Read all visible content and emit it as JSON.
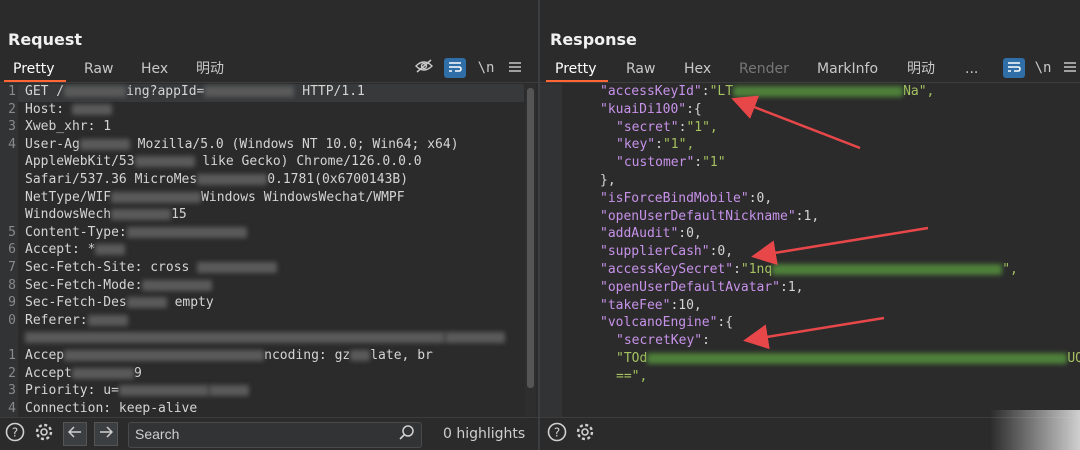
{
  "request": {
    "title": "Request",
    "tabs": [
      "Pretty",
      "Raw",
      "Hex",
      "明动"
    ],
    "active_tab": "Pretty",
    "toolbar_icons": [
      "eye-slash-icon",
      "wrap-icon",
      "newline-icon",
      "menu-icon"
    ],
    "newline_label": "\\n",
    "lines": [
      {
        "n": "1",
        "parts": [
          "GET /",
          "",
          "ing?appId=",
          "",
          " HTTP/1.1"
        ]
      },
      {
        "n": "2",
        "parts": [
          "Host: ",
          ""
        ]
      },
      {
        "n": "3",
        "parts": [
          "Xweb_xhr: 1"
        ]
      },
      {
        "n": "4",
        "parts": [
          "User-Ag",
          "",
          " Mozilla/5.0 (Windows NT 10.0; Win64; x64)"
        ]
      },
      {
        "n": "",
        "parts": [
          "AppleWebKit/53",
          "",
          " like Gecko) Chrome/126.0.0.0"
        ]
      },
      {
        "n": "",
        "parts": [
          "Safari/537.36 MicroMes",
          "",
          "0.1781(0x6700143B)"
        ]
      },
      {
        "n": "",
        "parts": [
          "NetType/WIF",
          "",
          "Windows WindowsWechat/WMPF"
        ]
      },
      {
        "n": "",
        "parts": [
          "WindowsWech",
          "",
          "15"
        ]
      },
      {
        "n": "5",
        "parts": [
          "Content-Type:",
          ""
        ]
      },
      {
        "n": "6",
        "parts": [
          "Accept: *",
          ""
        ]
      },
      {
        "n": "7",
        "parts": [
          "Sec-Fetch-Site: cross ",
          ""
        ]
      },
      {
        "n": "8",
        "parts": [
          "Sec-Fetch-Mode:",
          ""
        ]
      },
      {
        "n": "9",
        "parts": [
          "Sec-Fetch-Des",
          "",
          " empty"
        ]
      },
      {
        "n": "0",
        "parts": [
          "Referer:",
          ""
        ]
      },
      {
        "n": "",
        "parts": [
          "",
          ""
        ]
      },
      {
        "n": "1",
        "parts": [
          "Accep",
          "",
          "ncoding: gz",
          "",
          "late, br"
        ]
      },
      {
        "n": "2",
        "parts": [
          "Accept",
          "",
          "9"
        ]
      },
      {
        "n": "3",
        "parts": [
          "Priority: u=",
          "",
          ""
        ]
      },
      {
        "n": "4",
        "parts": [
          "Connection: keep-alive"
        ]
      }
    ]
  },
  "response": {
    "title": "Response",
    "tabs": [
      "Pretty",
      "Raw",
      "Hex",
      "Render",
      "MarkInfo",
      "明动",
      "..."
    ],
    "active_tab": "Pretty",
    "disabled_tab": "Render",
    "toolbar_icons": [
      "wrap-icon",
      "newline-icon",
      "menu-icon"
    ],
    "newline_label": "\\n",
    "lines": [
      {
        "indent": 1,
        "key": "\"accessKeyId\"",
        "sep": ":",
        "val": "\"LT",
        "blur": "green",
        "tail": "Na\","
      },
      {
        "indent": 1,
        "key": "\"kuaiDi100\"",
        "sep": ":{",
        "val": "",
        "blur": "",
        "tail": ""
      },
      {
        "indent": 2,
        "key": "\"secret\"",
        "sep": ":",
        "val": "\"1\",",
        "blur": "",
        "tail": ""
      },
      {
        "indent": 2,
        "key": "\"key\"",
        "sep": ":",
        "val": "\"1\",",
        "blur": "",
        "tail": ""
      },
      {
        "indent": 2,
        "key": "\"customer\"",
        "sep": ":",
        "val": "\"1\"",
        "blur": "",
        "tail": ""
      },
      {
        "indent": 1,
        "key": "",
        "sep": "},",
        "val": "",
        "blur": "",
        "tail": ""
      },
      {
        "indent": 1,
        "key": "\"isForceBindMobile\"",
        "sep": ":0,",
        "val": "",
        "blur": "",
        "tail": ""
      },
      {
        "indent": 1,
        "key": "\"openUserDefaultNickname\"",
        "sep": ":1,",
        "val": "",
        "blur": "",
        "tail": ""
      },
      {
        "indent": 1,
        "key": "\"addAudit\"",
        "sep": ":0,",
        "val": "",
        "blur": "",
        "tail": ""
      },
      {
        "indent": 1,
        "key": "\"supplierCash\"",
        "sep": ":0,",
        "val": "",
        "blur": "",
        "tail": ""
      },
      {
        "indent": 1,
        "key": "\"accessKeySecret\"",
        "sep": ":",
        "val": "\"1nq",
        "blur": "green",
        "tail": "\","
      },
      {
        "indent": 1,
        "key": "\"openUserDefaultAvatar\"",
        "sep": ":1,",
        "val": "",
        "blur": "",
        "tail": ""
      },
      {
        "indent": 1,
        "key": "\"takeFee\"",
        "sep": ":10,",
        "val": "",
        "blur": "",
        "tail": ""
      },
      {
        "indent": 1,
        "key": "\"volcanoEngine\"",
        "sep": ":{",
        "val": "",
        "blur": "",
        "tail": ""
      },
      {
        "indent": 2,
        "key": "\"secretKey\"",
        "sep": ":",
        "val": "",
        "blur": "",
        "tail": ""
      },
      {
        "indent": 2,
        "key": "",
        "sep": "",
        "val": "\"TOd",
        "blur": "green",
        "tail": "UQQ"
      },
      {
        "indent": 2,
        "key": "",
        "sep": "",
        "val": "==\",",
        "blur": "",
        "tail": ""
      }
    ]
  },
  "bottom_bar": {
    "search_placeholder": "Search",
    "highlights": "0 highlights"
  },
  "colors": {
    "accent_underline": "#ff6633",
    "json_key": "#c792ea",
    "json_string": "#a5c261",
    "annotation_arrow": "#e8474a",
    "active_toggle": "#2f6ea6"
  }
}
